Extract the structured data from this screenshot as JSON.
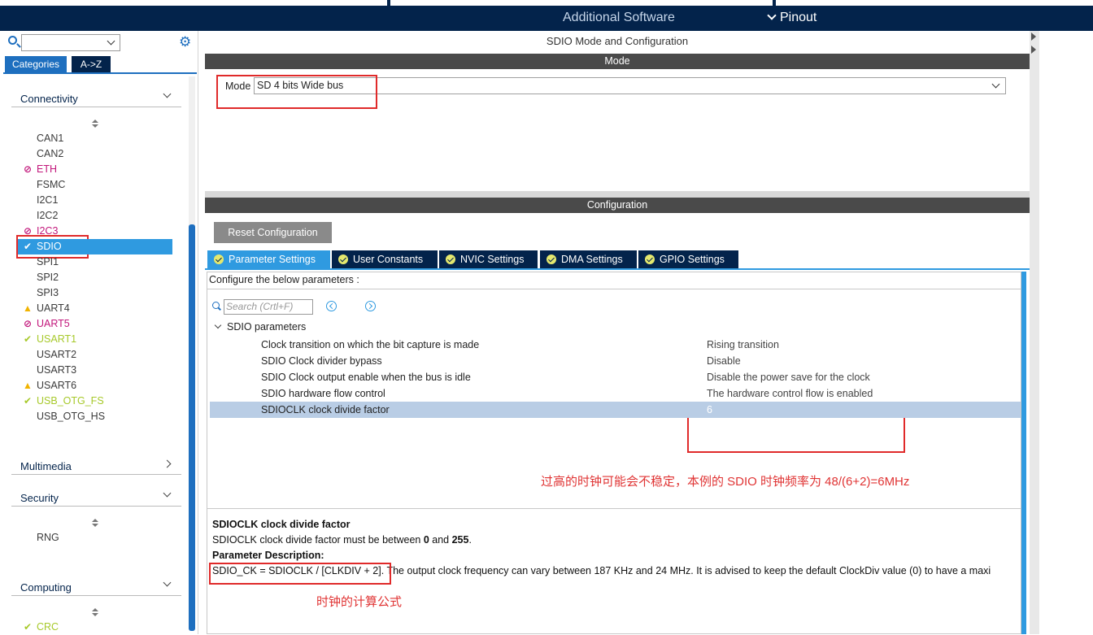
{
  "topbar": {
    "additional_software": "Additional Software",
    "pinout": "Pinout"
  },
  "left": {
    "tabs": {
      "categories": "Categories",
      "az": "A->Z"
    },
    "groups": {
      "connectivity": "Connectivity",
      "multimedia": "Multimedia",
      "security": "Security",
      "computing": "Computing"
    },
    "connectivity_items": [
      {
        "label": "CAN1",
        "status": "normal"
      },
      {
        "label": "CAN2",
        "status": "normal"
      },
      {
        "label": "ETH",
        "status": "blocked"
      },
      {
        "label": "FSMC",
        "status": "normal"
      },
      {
        "label": "I2C1",
        "status": "normal"
      },
      {
        "label": "I2C2",
        "status": "normal"
      },
      {
        "label": "I2C3",
        "status": "blocked"
      },
      {
        "label": "SDIO",
        "status": "selected"
      },
      {
        "label": "SPI1",
        "status": "normal"
      },
      {
        "label": "SPI2",
        "status": "normal"
      },
      {
        "label": "SPI3",
        "status": "normal"
      },
      {
        "label": "UART4",
        "status": "warn"
      },
      {
        "label": "UART5",
        "status": "blocked"
      },
      {
        "label": "USART1",
        "status": "ok"
      },
      {
        "label": "USART2",
        "status": "normal"
      },
      {
        "label": "USART3",
        "status": "normal"
      },
      {
        "label": "USART6",
        "status": "warn"
      },
      {
        "label": "USB_OTG_FS",
        "status": "ok"
      },
      {
        "label": "USB_OTG_HS",
        "status": "normal"
      }
    ],
    "security_items": [
      {
        "label": "RNG",
        "status": "normal"
      }
    ],
    "computing_items": [
      {
        "label": "CRC",
        "status": "ok"
      }
    ]
  },
  "main": {
    "title": "SDIO Mode and Configuration",
    "mode_bar": "Mode",
    "mode_label": "Mode",
    "mode_value": "SD 4 bits Wide bus",
    "config_bar": "Configuration",
    "reset_button": "Reset Configuration",
    "tabs": [
      "Parameter Settings",
      "User Constants",
      "NVIC Settings",
      "DMA Settings",
      "GPIO Settings"
    ],
    "hint": "Configure the below parameters :",
    "search_placeholder": "Search (Crtl+F)",
    "tree_group": "SDIO parameters",
    "params": [
      {
        "name": "Clock transition on which the bit capture is made",
        "value": "Rising transition"
      },
      {
        "name": "SDIO Clock divider bypass",
        "value": "Disable"
      },
      {
        "name": "SDIO Clock output enable when the bus is idle",
        "value": "Disable the power save for the clock"
      },
      {
        "name": "SDIO hardware flow control",
        "value": "The hardware control flow is enabled"
      },
      {
        "name": "SDIOCLK clock divide factor",
        "value": "6"
      }
    ],
    "note1": "过高的时钟可能会不稳定，本例的 SDIO 时钟频率为 48/(6+2)=6MHz",
    "desc": {
      "title": "SDIOCLK clock divide factor",
      "range_prefix": "SDIOCLK clock divide factor must be between ",
      "min": "0",
      "and": " and ",
      "max": "255",
      "period": ".",
      "param_desc_label": "Parameter Description:",
      "formula": "SDIO_CK = SDIOCLK / [CLKDIV + 2]",
      "formula_rest": ". The output clock frequency can vary between 187 KHz and 24 MHz. It is advised to keep the default ClockDiv value (0) to have a maxi"
    },
    "note2": "时钟的计算公式"
  },
  "colors": {
    "navy": "#03234b",
    "accent_blue": "#2f9ae0",
    "ok_green": "#a7c92a",
    "blocked_magenta": "#c2177b",
    "warn_yellow": "#f1b300",
    "annotation_red": "#e02a2a"
  }
}
